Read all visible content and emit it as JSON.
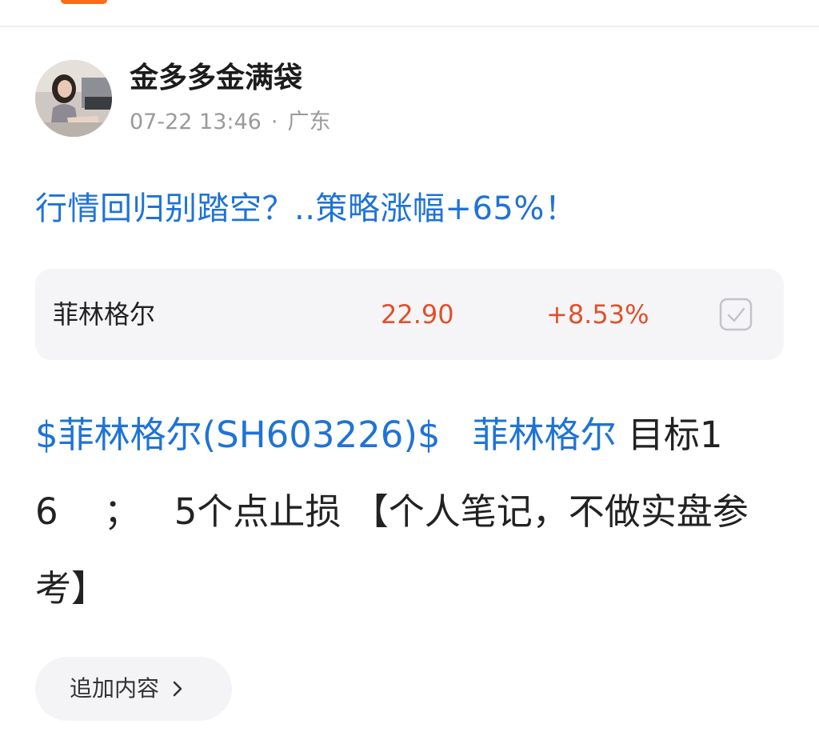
{
  "colors": {
    "accent_orange": "#ff6a1a",
    "link_blue": "#1f73d6",
    "rise_red": "#e0502b",
    "muted_gray": "#9a9a9a"
  },
  "post": {
    "author": {
      "name": "金多多金满袋",
      "avatar": "avatar-photo",
      "date": "07-22 13:46",
      "separator": "·",
      "location": "广东"
    },
    "title": "行情回归别踏空？..策略涨幅+65%！",
    "stock_card": {
      "name": "菲林格尔",
      "price": "22.90",
      "change": "+8.53%",
      "icon": "checkbox-icon"
    },
    "body": {
      "stock_tag": "$菲林格尔(SH603226)$",
      "mention": "菲林格尔",
      "text_1": "目标16",
      "separator": "；",
      "text_2": "5个点止损 【个人笔记，不做实盘参考】"
    },
    "add_content": {
      "label": "追加内容",
      "icon": "chevron-right-icon"
    }
  }
}
